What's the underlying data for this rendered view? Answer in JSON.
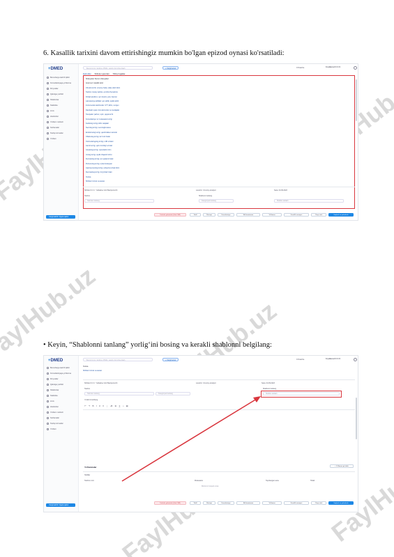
{
  "watermark": "FaylHub.uz",
  "caption1": "6.  Kasallik tarixini davom ettirishingiz mumkin bo'lgan epizod oynasi ko'rsatiladi:",
  "caption2": "• Keyin, “Shablonni tanlang” yorlig‘ini bosing va kerakli shablonni belgilang:",
  "app": {
    "logo_plus": "+",
    "logo": "DMED",
    "search_placeholder": "Bemorni ism, familiya, PINFL, telefon bo'yicha izlash",
    "new_patient": "+ Yangi bemor",
    "lang": "O'zbekcha",
    "user": "Foydalanuvchi F.I.O.",
    "nav": [
      "Bemorlarga tashrif qilish",
      "Konsultatsiyaga yo'llanma",
      "Ro'yxatlar",
      "Qabulga yozilish",
      "Shablonlar",
      "Statistika",
      "Arxiv",
      "Hisobotlar",
      "Yordam markazi",
      "Sozlamalar",
      "Tashqi xizmatlar",
      "Yordam"
    ],
    "side_button": "Yangi tashrif / Qayta qabul",
    "tabs": [
      "Epizodlar",
      "Shifokor qarorlari",
      "Tibbiy hujjatlar"
    ],
    "doc_lines": [
      "Shikoyatlar: Bemor shikoyatlari",
      "Anamnez: kasallik tarixi",
      "Ob'ektiv ko'rik: umumiy holat, nafas olish tizimi",
      "Tashxis: Asosiy tashxis, qo'shimcha tashxis",
      "Fizikal tekshiruv: qon bosimi, puls, harorat",
      "Laboratoriya tahlillari: qon tahlili, siydik tahlili",
      "Instrumental tekshiruvlar: UTT, EKG, rentgen",
      "Davolash rejasi: dori-darmonlar va muolajalar",
      "Tavsiyalar: parhez, rejim, qayta ko'rik",
      "Konsultatsiya: tor mutaxassis ko'rigi",
      "Kardiolog ko'rigi, EKG natijalari",
      "Nevrolog ko'rigi, nevrologik status",
      "Endokrinolog ko'rigi, qandli diabet nazorati",
      "Oftalmolog ko'rigi, ko'z tubi holati",
      "Otorinolaringolog ko'rigi, LOR a'zolari",
      "Jarroh ko'rigi, qorin bo'shlig'i a'zolari",
      "Ginekolog ko'rigi, reproduktiv tizim",
      "Urolog ko'rigi, siydik chiqarish tizimi",
      "Dermatolog ko'rigi, teri qoplami holati",
      "Pulmonolog ko'rigi, o'pka funksiyasi",
      "Gastroenterolog ko'rigi, oshqozon-ichak tizimi",
      "Revmatolog ko'rigi, bo'g'imlar holati",
      "Xulosa",
      "Shifokor imzosi va sanasi"
    ],
    "doctor_label": "Shifokor F.I.O.: Yuldashev Aziz Baxtiyorovich",
    "specialty_label": "Lavozim: Umumiy amaliyot",
    "date_label": "Sana: 04.09.2023",
    "diagnosis_label": "Tashxis",
    "diagnosis_placeholder": "Tashxisni tanlang",
    "template_tab": "Shablonni tanlang",
    "template_placeholder": "Shablon tanlash",
    "category_placeholder": "Kategoriyani tanlang",
    "editor_placeholder": "Yozishni boshlang",
    "editor_tools": "↶ ↷ B I U ≡ ⋮ ≔ ⊞ ∑ ⌂ ▤",
    "section_title": "Yo'llanmalar",
    "section_button": "+ Yo'llanma qo'shish",
    "table_title": "Tahlillar",
    "table_headers": [
      "Tashxis nomi",
      "Mutaxassis",
      "Tayinlangan sana",
      "Holati"
    ],
    "table_empty": "Ma'lumot mavjud emas",
    "bottom_buttons": [
      "Tashrifni yakunlash (Kod: TAF)",
      "Tahlil",
      "Retsept",
      "Konsultatsiya",
      "Ma'lumotnoma",
      "Yo'llanma",
      "Kasallik varaqasi",
      "Chop etish",
      "Saqlash va yakunlash"
    ]
  }
}
